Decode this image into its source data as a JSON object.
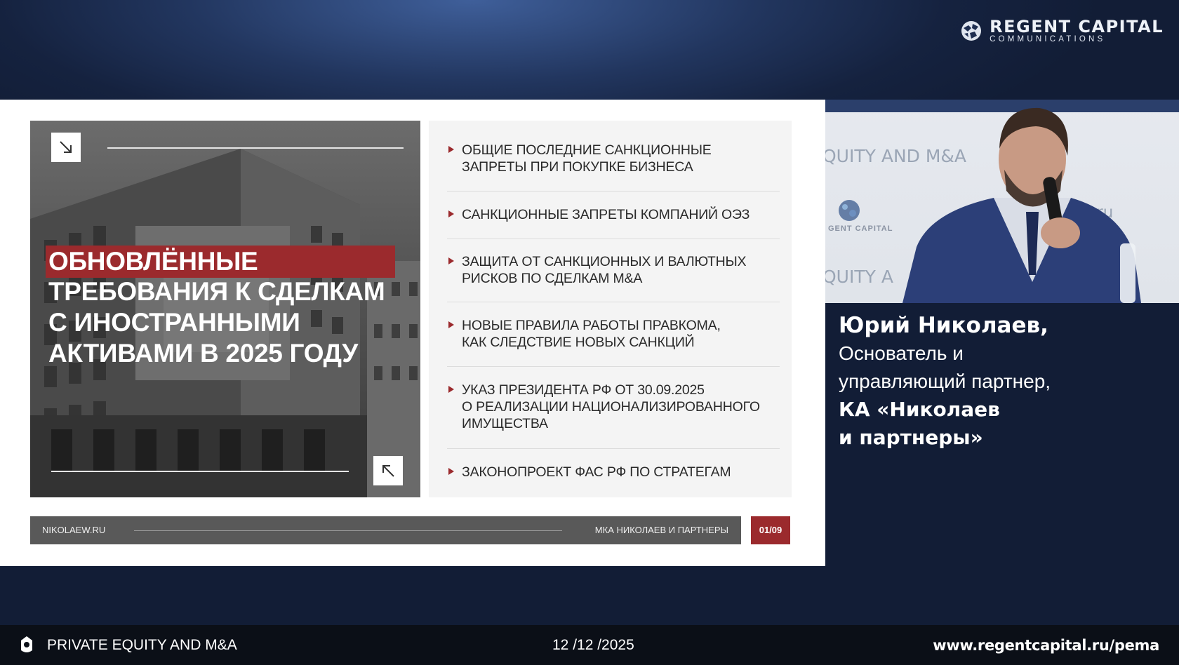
{
  "brand": {
    "line1": "REGENT CAPITAL",
    "line2": "COMMUNICATIONS"
  },
  "slide": {
    "title_highlight": "ОБНОВЛЁННЫЕ",
    "title_lines": [
      "ТРЕБОВАНИЯ К СДЕЛКАМ",
      "С ИНОСТРАННЫМИ",
      "АКТИВАМИ В 2025 ГОДУ"
    ],
    "agenda": [
      {
        "lines": [
          "ОБЩИЕ ПОСЛЕДНИЕ САНКЦИОННЫЕ",
          "ЗАПРЕТЫ ПРИ ПОКУПКЕ БИЗНЕСА"
        ]
      },
      {
        "lines": [
          "САНКЦИОННЫЕ ЗАПРЕТЫ КОМПАНИЙ ОЭЗ"
        ]
      },
      {
        "lines": [
          "ЗАЩИТА ОТ САНКЦИОННЫХ И ВАЛЮТНЫХ",
          "РИСКОВ ПО СДЕЛКАМ M&A"
        ]
      },
      {
        "lines": [
          "НОВЫЕ ПРАВИЛА РАБОТЫ ПРАВКОМА,",
          "КАК СЛЕДСТВИЕ НОВЫХ САНКЦИЙ"
        ]
      },
      {
        "lines": [
          "УКАЗ ПРЕЗИДЕНТА РФ ОТ 30.09.2025",
          "О РЕАЛИЗАЦИИ НАЦИОНАЛИЗИРОВАННОГО",
          "ИМУЩЕСТВА"
        ]
      },
      {
        "lines": [
          "ЗАКОНОПРОЕКТ ФАС РФ ПО СТРАТЕГАМ"
        ]
      }
    ],
    "footer": {
      "site": "NIKOLAEW.RU",
      "firm": "МКА НИКОЛАЕВ И ПАРТНЕРЫ",
      "page": "01/09"
    }
  },
  "video": {
    "backdrop_text_1": "QUITY AND M&A",
    "backdrop_text_2": "QUITY A",
    "backdrop_text_3": ".ru",
    "backdrop_logo": "GENT CAPITAL"
  },
  "speaker": {
    "name": "Юрий Николаев,",
    "role_lines": [
      "Основатель и",
      "управляющий партнер,"
    ],
    "org_lines": [
      "КА «Николаев",
      "и партнеры»"
    ]
  },
  "bottom_bar": {
    "event": "PRIVATE EQUITY AND M&A",
    "date": "12 /12 /2025",
    "url": "www.regentcapital.ru/pema"
  },
  "colors": {
    "accent_red": "#9b2a2d",
    "dark_navy": "#15223f",
    "bar_gray": "#595959"
  },
  "icons": [
    "globe-logo-icon",
    "arrow-down-right-icon",
    "arrow-up-left-icon",
    "bullet-triangle-icon",
    "event-emblem-icon"
  ]
}
